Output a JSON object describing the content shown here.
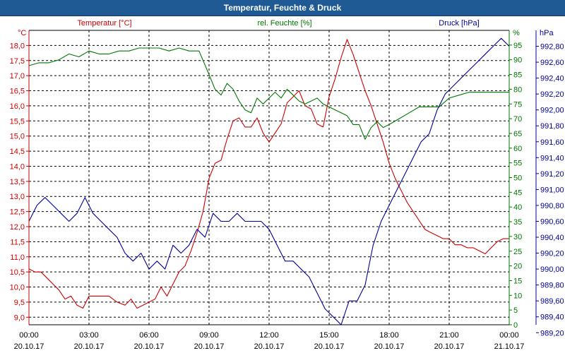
{
  "chart_data": {
    "type": "line",
    "title": "Temperatur, Feuchte & Druck",
    "colors": {
      "temperature": "#cc0000",
      "humidity": "#007700",
      "pressure": "#000099",
      "title_bg": "#1f5a94"
    },
    "axes": {
      "left": {
        "unit": "°C",
        "min": 8.75,
        "max": 18.5,
        "ticks": [
          "9,0",
          "9,5",
          "10,0",
          "10,5",
          "11,0",
          "11,5",
          "12,0",
          "12,5",
          "13,0",
          "13,5",
          "14,0",
          "14,5",
          "15,0",
          "15,5",
          "16,0",
          "16,5",
          "17,0",
          "17,5",
          "18,0"
        ],
        "tick_values": [
          9,
          9.5,
          10,
          10.5,
          11,
          11.5,
          12,
          12.5,
          13,
          13.5,
          14,
          14.5,
          15,
          15.5,
          16,
          16.5,
          17,
          17.5,
          18
        ]
      },
      "right1": {
        "unit": "%",
        "min": 0,
        "max": 100,
        "ticks": [
          "0",
          "5",
          "10",
          "15",
          "20",
          "25",
          "30",
          "35",
          "40",
          "45",
          "50",
          "55",
          "60",
          "65",
          "70",
          "75",
          "80",
          "85",
          "90",
          "95"
        ],
        "tick_values": [
          0,
          5,
          10,
          15,
          20,
          25,
          30,
          35,
          40,
          45,
          50,
          55,
          60,
          65,
          70,
          75,
          80,
          85,
          90,
          95
        ]
      },
      "right2": {
        "unit": "hPa",
        "min": 989.3,
        "max": 993.0,
        "ticks": [
          "989,20",
          "989,40",
          "989,60",
          "989,80",
          "990,00",
          "990,20",
          "990,40",
          "990,60",
          "990,80",
          "991,00",
          "991,20",
          "991,40",
          "991,60",
          "991,80",
          "992,00",
          "992,20",
          "992,40",
          "992,60",
          "992,80"
        ],
        "tick_values": [
          989.2,
          989.4,
          989.6,
          989.8,
          990.0,
          990.2,
          990.4,
          990.6,
          990.8,
          991.0,
          991.2,
          991.4,
          991.6,
          991.8,
          992.0,
          992.2,
          992.4,
          992.6,
          992.8
        ]
      }
    },
    "x_ticks": [
      {
        "time": "00:00",
        "date": "20.10.17"
      },
      {
        "time": "03:00",
        "date": "20.10.17"
      },
      {
        "time": "06:00",
        "date": "20.10.17"
      },
      {
        "time": "09:00",
        "date": "20.10.17"
      },
      {
        "time": "12:00",
        "date": "20.10.17"
      },
      {
        "time": "15:00",
        "date": "20.10.17"
      },
      {
        "time": "18:00",
        "date": "20.10.17"
      },
      {
        "time": "21:00",
        "date": "20.10.17"
      },
      {
        "time": "00:00",
        "date": "21.10.17"
      }
    ],
    "xlim_hours": [
      0,
      24
    ],
    "grid": true,
    "series": [
      {
        "name": "Temperatur [°C]",
        "axis": "left",
        "color": "#cc0000",
        "x": [
          0,
          0.3,
          0.6,
          0.9,
          1.2,
          1.5,
          1.8,
          2.1,
          2.4,
          2.7,
          3.0,
          3.3,
          3.6,
          4.0,
          4.4,
          4.8,
          5.1,
          5.4,
          5.7,
          6.0,
          6.3,
          6.6,
          6.9,
          7.2,
          7.5,
          7.8,
          8.1,
          8.4,
          8.7,
          9.0,
          9.3,
          9.6,
          9.9,
          10.2,
          10.5,
          10.8,
          11.1,
          11.4,
          11.7,
          12.0,
          12.3,
          12.6,
          12.9,
          13.2,
          13.5,
          13.8,
          14.1,
          14.4,
          14.7,
          15.0,
          15.3,
          15.6,
          15.9,
          16.2,
          16.5,
          16.8,
          17.1,
          17.4,
          17.7,
          18.0,
          18.3,
          18.6,
          18.9,
          19.2,
          19.5,
          19.8,
          20.1,
          20.4,
          20.7,
          21.0,
          21.3,
          21.6,
          21.9,
          22.2,
          22.5,
          22.8,
          23.1,
          23.4,
          23.7,
          24.0
        ],
        "y": [
          10.6,
          10.5,
          10.5,
          10.3,
          10.1,
          9.9,
          9.6,
          9.7,
          9.4,
          9.3,
          9.7,
          9.7,
          9.7,
          9.7,
          9.5,
          9.4,
          9.6,
          9.3,
          9.4,
          9.5,
          9.6,
          10.0,
          9.7,
          10.1,
          10.5,
          10.7,
          11.2,
          11.8,
          12.5,
          13.6,
          14.1,
          14.2,
          14.9,
          15.5,
          15.6,
          15.3,
          15.3,
          15.6,
          15.1,
          14.8,
          15.1,
          15.4,
          16.1,
          16.3,
          16.5,
          16.0,
          15.9,
          15.4,
          15.3,
          16.3,
          16.9,
          17.6,
          18.2,
          17.7,
          17.1,
          16.5,
          16.0,
          15.4,
          14.8,
          14.1,
          13.6,
          13.2,
          12.8,
          12.5,
          12.2,
          11.9,
          11.8,
          11.7,
          11.6,
          11.6,
          11.4,
          11.4,
          11.3,
          11.3,
          11.2,
          11.1,
          11.3,
          11.5,
          11.6,
          11.6
        ]
      },
      {
        "name": "rel. Feuchte [%]",
        "axis": "right1",
        "color": "#007700",
        "x": [
          0,
          0.5,
          1.0,
          1.5,
          2.0,
          2.5,
          3.0,
          3.5,
          4.0,
          4.5,
          5.0,
          5.5,
          6.0,
          6.5,
          7.0,
          7.5,
          8.0,
          8.5,
          9.0,
          9.3,
          9.6,
          9.9,
          10.2,
          10.5,
          10.8,
          11.1,
          11.4,
          11.7,
          12.0,
          12.3,
          12.6,
          12.9,
          13.2,
          13.5,
          13.8,
          14.1,
          14.4,
          14.7,
          15.0,
          15.3,
          15.6,
          15.9,
          16.2,
          16.5,
          16.8,
          17.1,
          17.4,
          17.7,
          18.0,
          18.5,
          19.0,
          19.5,
          20.0,
          20.5,
          21.0,
          21.5,
          22.0,
          22.5,
          23.0,
          23.5,
          24.0
        ],
        "y": [
          88,
          89,
          89,
          90,
          92,
          91,
          93,
          92,
          92,
          93,
          93,
          94,
          94,
          94,
          93,
          94,
          93,
          93,
          85,
          80,
          78,
          82,
          80,
          76,
          73,
          72,
          77,
          75,
          77,
          79,
          77,
          80,
          78,
          76,
          75,
          76,
          77,
          75,
          74,
          73,
          72,
          71,
          68,
          68,
          63,
          67,
          69,
          67,
          68,
          70,
          72,
          74,
          74,
          74,
          77,
          78,
          79,
          79,
          79,
          79,
          79
        ]
      },
      {
        "name": "Druck [hPa]",
        "axis": "right2",
        "color": "#000099",
        "x": [
          0,
          0.4,
          0.8,
          1.2,
          1.6,
          2.0,
          2.4,
          2.8,
          3.2,
          3.6,
          4.0,
          4.4,
          4.8,
          5.2,
          5.6,
          6.0,
          6.4,
          6.8,
          7.2,
          7.6,
          8.0,
          8.4,
          8.8,
          9.2,
          9.6,
          10.0,
          10.4,
          10.8,
          11.2,
          11.6,
          12.0,
          12.4,
          12.8,
          13.2,
          13.6,
          14.0,
          14.4,
          14.8,
          15.2,
          15.6,
          16.0,
          16.4,
          16.8,
          17.2,
          17.6,
          18.0,
          18.4,
          18.8,
          19.2,
          19.6,
          20.0,
          20.4,
          20.8,
          21.2,
          21.6,
          22.0,
          22.4,
          22.8,
          23.2,
          23.6,
          24.0
        ],
        "y": [
          990.6,
          990.8,
          990.9,
          990.8,
          990.7,
          990.6,
          990.7,
          990.9,
          990.7,
          990.6,
          990.5,
          990.4,
          990.2,
          990.1,
          990.2,
          990.0,
          990.1,
          990.0,
          990.3,
          990.2,
          990.3,
          990.5,
          990.4,
          990.7,
          990.6,
          990.6,
          990.7,
          990.6,
          990.6,
          990.6,
          990.5,
          990.3,
          990.1,
          990.1,
          990.0,
          989.9,
          989.7,
          989.5,
          989.4,
          989.3,
          989.6,
          989.6,
          989.8,
          990.3,
          990.6,
          990.8,
          991.0,
          991.2,
          991.4,
          991.6,
          991.7,
          992.0,
          992.2,
          992.3,
          992.4,
          992.5,
          992.6,
          992.7,
          992.8,
          992.9,
          992.8
        ]
      }
    ]
  }
}
